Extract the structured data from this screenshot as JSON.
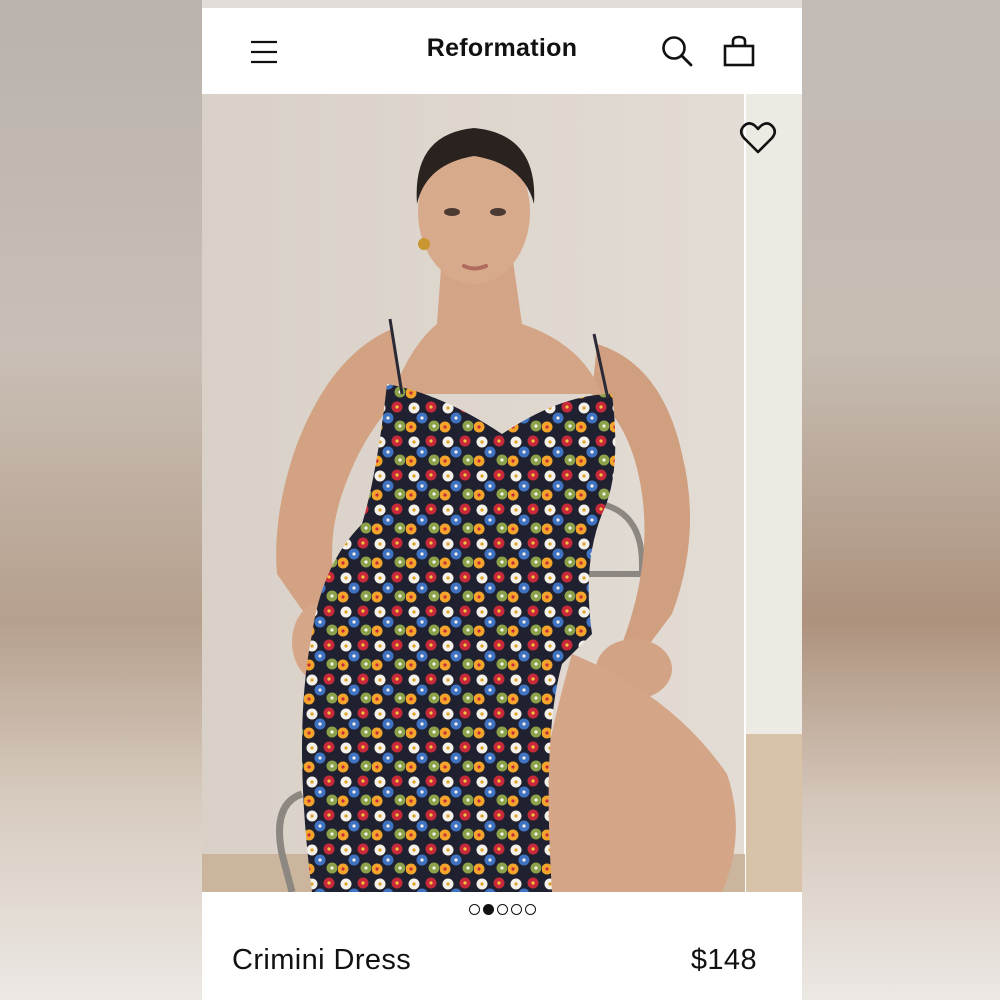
{
  "header": {
    "brand": "Reformation",
    "menu_icon": "menu-icon",
    "search_icon": "search-icon",
    "bag_icon": "shopping-bag-icon"
  },
  "gallery": {
    "image_description": "product photo",
    "wishlist_icon": "heart-icon",
    "slide_count": 5,
    "active_slide": 2
  },
  "product": {
    "name": "Crimini Dress",
    "price": "$148"
  },
  "colors": {
    "text": "#111111",
    "background": "#ffffff"
  }
}
